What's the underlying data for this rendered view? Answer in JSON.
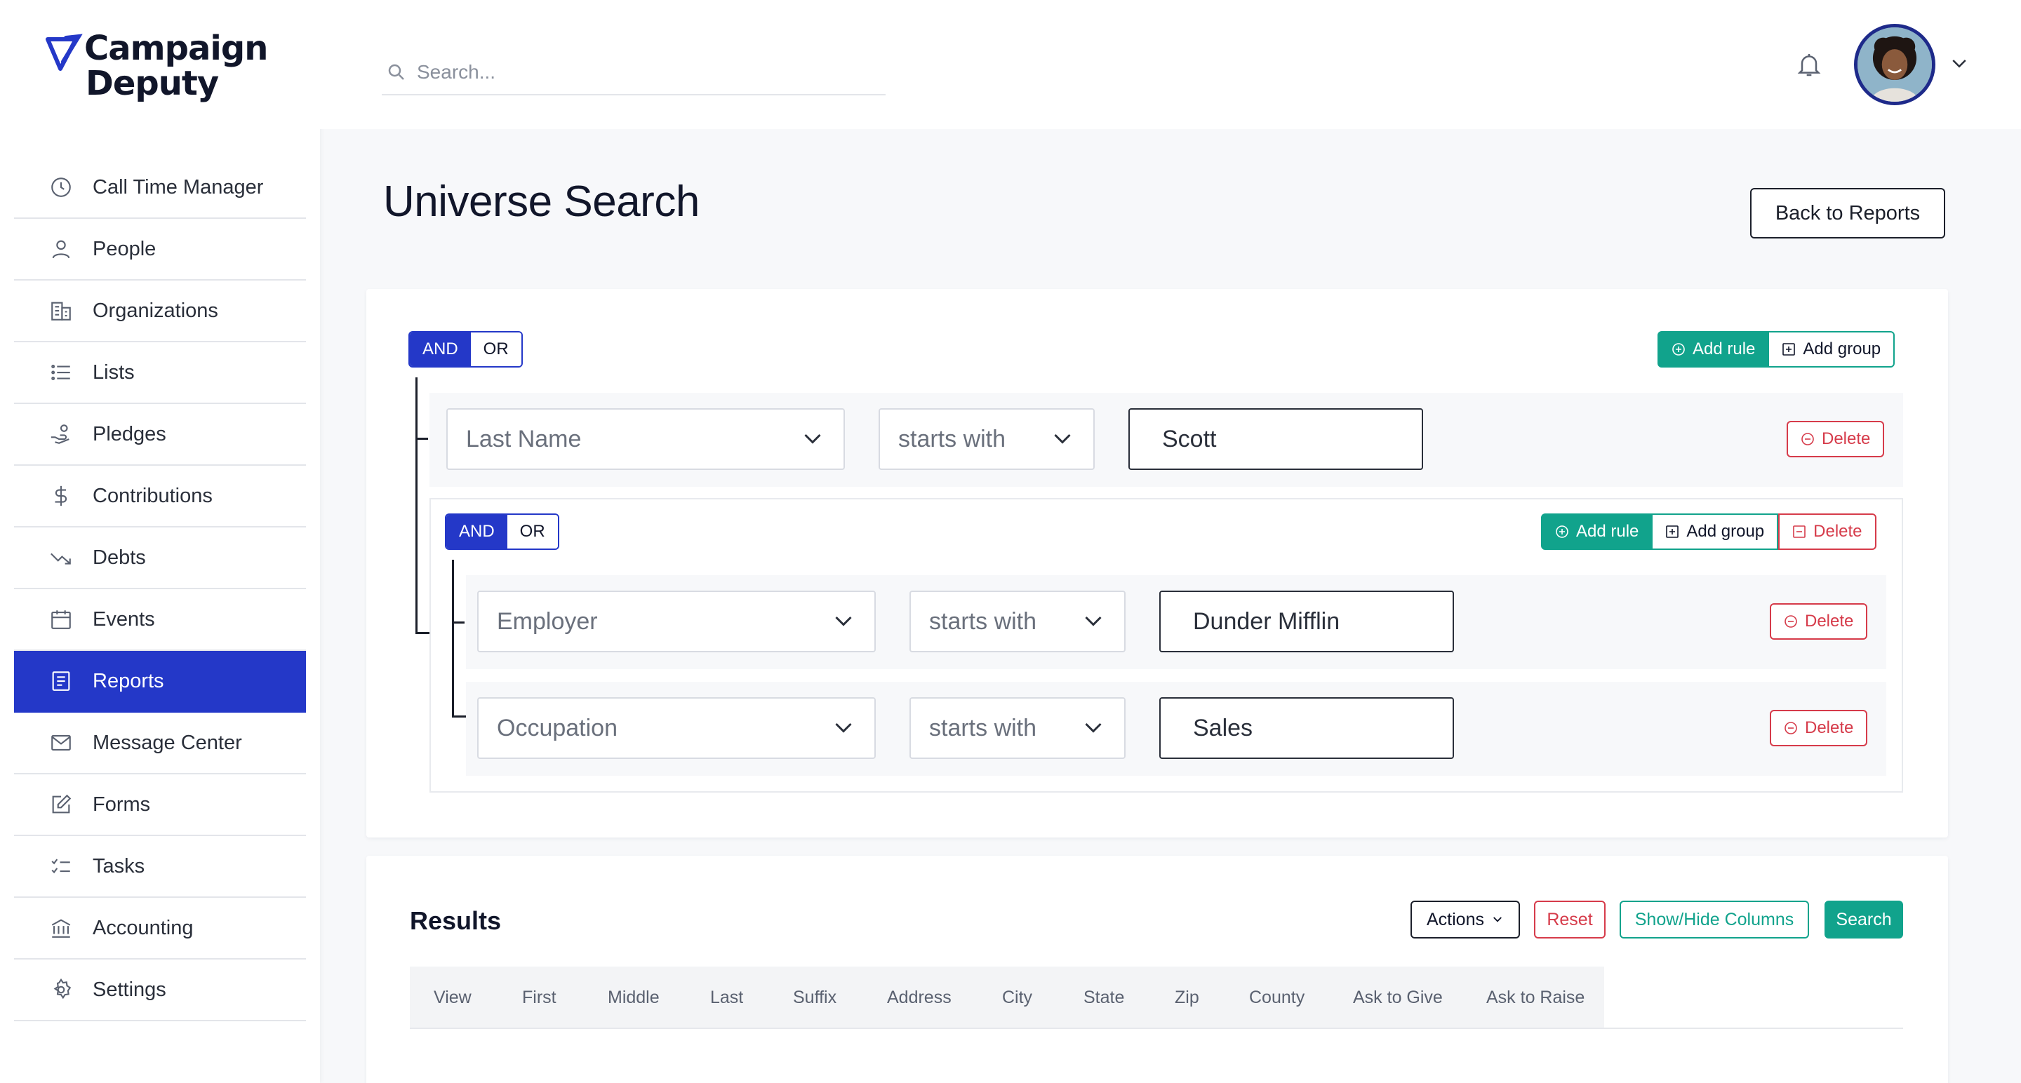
{
  "brand": {
    "line1": "Campaign",
    "line2": "Deputy",
    "color": "#2438c8"
  },
  "sidebar": {
    "items": [
      {
        "label": "Call Time Manager",
        "icon": "clock-icon"
      },
      {
        "label": "People",
        "icon": "person-icon"
      },
      {
        "label": "Organizations",
        "icon": "building-icon"
      },
      {
        "label": "Lists",
        "icon": "list-icon"
      },
      {
        "label": "Pledges",
        "icon": "hand-coins-icon"
      },
      {
        "label": "Contributions",
        "icon": "dollar-icon"
      },
      {
        "label": "Debts",
        "icon": "trending-down-icon"
      },
      {
        "label": "Events",
        "icon": "calendar-icon"
      },
      {
        "label": "Reports",
        "icon": "report-icon",
        "active": true
      },
      {
        "label": "Message Center",
        "icon": "mail-icon"
      },
      {
        "label": "Forms",
        "icon": "edit-form-icon"
      },
      {
        "label": "Tasks",
        "icon": "tasks-icon"
      },
      {
        "label": "Accounting",
        "icon": "bank-icon"
      },
      {
        "label": "Settings",
        "icon": "gear-icon"
      }
    ]
  },
  "topbar": {
    "search_placeholder": "Search...",
    "search_value": ""
  },
  "page": {
    "title": "Universe Search",
    "back_label": "Back to Reports"
  },
  "builder": {
    "root": {
      "and_label": "AND",
      "or_label": "OR",
      "combinator": "AND",
      "add_rule_label": "Add rule",
      "add_group_label": "Add group",
      "rules": [
        {
          "field": "Last Name",
          "operator": "starts with",
          "value": "Scott",
          "delete_label": "Delete"
        }
      ]
    },
    "nested": {
      "and_label": "AND",
      "or_label": "OR",
      "combinator": "AND",
      "add_rule_label": "Add rule",
      "add_group_label": "Add group",
      "delete_label": "Delete",
      "rules": [
        {
          "field": "Employer",
          "operator": "starts with",
          "value": "Dunder Mifflin",
          "delete_label": "Delete"
        },
        {
          "field": "Occupation",
          "operator": "starts with",
          "value": "Sales",
          "delete_label": "Delete"
        }
      ]
    }
  },
  "results": {
    "title": "Results",
    "actions_label": "Actions",
    "reset_label": "Reset",
    "showhide_label": "Show/Hide Columns",
    "search_label": "Search",
    "columns": [
      "View",
      "First",
      "Middle",
      "Last",
      "Suffix",
      "Address",
      "City",
      "State",
      "Zip",
      "County",
      "Ask to Give",
      "Ask to Raise"
    ]
  },
  "colors": {
    "primary": "#2438c8",
    "teal": "#11a38c",
    "danger": "#d63b4a"
  }
}
